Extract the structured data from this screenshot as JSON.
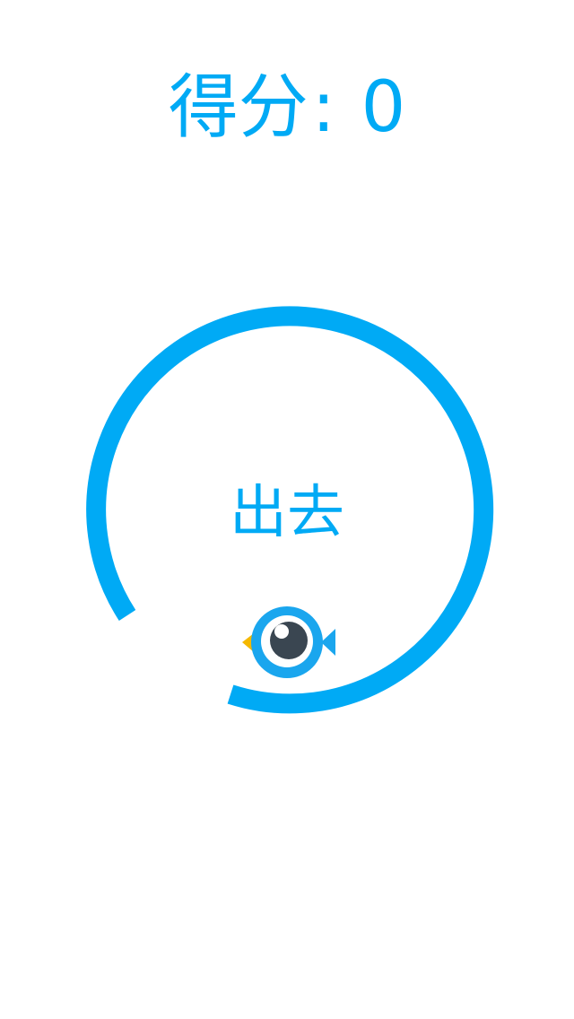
{
  "hud": {
    "score_label": "得分",
    "score_separator": ":",
    "score_value": "0"
  },
  "game": {
    "center_text": "出去",
    "ring_color": "#00aaf5",
    "player": {
      "icon": "fish-bird-icon",
      "body_color": "#1aa6ee",
      "eye_color": "#3a4651",
      "beak_color": "#f5b800"
    }
  }
}
